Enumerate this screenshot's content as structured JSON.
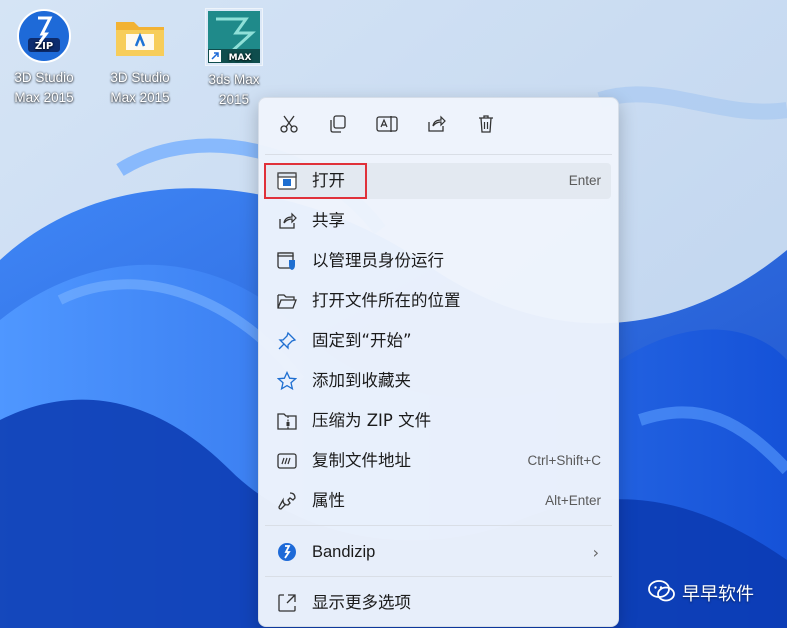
{
  "desktop": {
    "icons": [
      {
        "line1": "3D Studio",
        "line2": "Max 2015",
        "icon": "bandizip-zip-icon",
        "color": "#1e6ad8"
      },
      {
        "line1": "3D Studio",
        "line2": "Max 2015",
        "icon": "folder-icon",
        "color": "#f5c542"
      },
      {
        "line1": "3ds Max",
        "line2": "2015",
        "icon": "3ds-max-app-icon",
        "color": "#1f8a8a"
      }
    ]
  },
  "context_menu": {
    "toolbar": [
      {
        "name": "cut-icon",
        "tooltip": "剪切"
      },
      {
        "name": "copy-icon",
        "tooltip": "复制"
      },
      {
        "name": "rename-icon",
        "tooltip": "重命名"
      },
      {
        "name": "share-icon",
        "tooltip": "共享"
      },
      {
        "name": "delete-icon",
        "tooltip": "删除"
      }
    ],
    "items": [
      {
        "label": "打开",
        "shortcut": "Enter",
        "icon": "open-window-icon"
      },
      {
        "label": "共享",
        "shortcut": "",
        "icon": "share-icon"
      },
      {
        "label": "以管理员身份运行",
        "shortcut": "",
        "icon": "admin-shield-icon"
      },
      {
        "label": "打开文件所在的位置",
        "shortcut": "",
        "icon": "folder-open-icon"
      },
      {
        "label": "固定到“开始”",
        "shortcut": "",
        "icon": "pin-icon"
      },
      {
        "label": "添加到收藏夹",
        "shortcut": "",
        "icon": "star-icon"
      },
      {
        "label": "压缩为 ZIP 文件",
        "shortcut": "",
        "icon": "zip-folder-icon"
      },
      {
        "label": "复制文件地址",
        "shortcut": "Ctrl+Shift+C",
        "icon": "copy-path-icon"
      },
      {
        "label": "属性",
        "shortcut": "Alt+Enter",
        "icon": "wrench-icon"
      },
      {
        "label": "Bandizip",
        "shortcut": "",
        "icon": "bandizip-icon",
        "submenu": "›"
      },
      {
        "label": "显示更多选项",
        "shortcut": "",
        "icon": "more-options-icon"
      }
    ]
  },
  "watermark": {
    "text": "早早软件",
    "icon": "wechat-icon"
  },
  "colors": {
    "accent": "#0067c0",
    "highlight_border": "#e0313a"
  }
}
